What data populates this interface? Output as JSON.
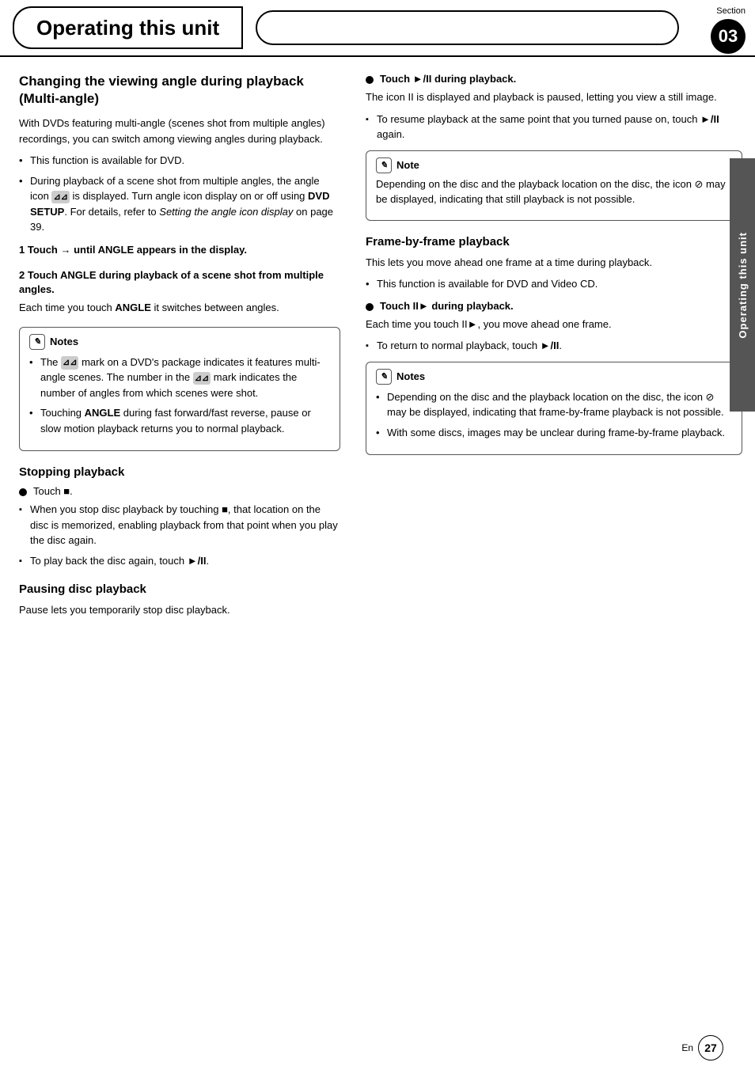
{
  "header": {
    "title": "Operating this unit",
    "section_label": "Section",
    "section_number": "03"
  },
  "side_tab": {
    "text": "Operating this unit"
  },
  "footer": {
    "lang": "En",
    "page_number": "27"
  },
  "left_column": {
    "section1": {
      "heading": "Changing the viewing angle during playback (Multi-angle)",
      "intro": "With DVDs featuring multi-angle (scenes shot from multiple angles) recordings, you can switch among viewing angles during playback.",
      "bullets": [
        "This function is available for DVD.",
        "During playback of a scene shot from multiple angles, the angle icon      is displayed. Turn angle icon display on or off using DVD SETUP. For details, refer to Setting the angle icon display on page 39."
      ],
      "step1_heading": "1   Touch → until ANGLE appears in the display.",
      "step2_heading": "2   Touch ANGLE during playback of a scene shot from multiple angles.",
      "step2_body": "Each time you touch ANGLE it switches between angles.",
      "notes_title": "Notes",
      "notes": [
        "The      mark on a DVD's package indicates it features multi-angle scenes. The number in the      mark indicates the number of angles from which scenes were shot.",
        "Touching ANGLE during fast forward/fast reverse, pause or slow motion playback returns you to normal playback."
      ]
    },
    "section2": {
      "heading": "Stopping playback",
      "circle_bullet": "Touch ■.",
      "square_bullets": [
        "When you stop disc playback by touching ■, that location on the disc is memorized, enabling playback from that point when you play the disc again.",
        "To play back the disc again, touch ►/II."
      ]
    },
    "section3": {
      "heading": "Pausing disc playback",
      "intro": "Pause lets you temporarily stop disc playback."
    }
  },
  "right_column": {
    "section1": {
      "circle_bullet": "Touch ►/II during playback.",
      "body1": "The icon II is displayed and playback is paused, letting you view a still image.",
      "square_bullet": "To resume playback at the same point that you turned pause on, touch ►/II again.",
      "note_title": "Note",
      "note_body": "Depending on the disc and the playback location on the disc, the icon ⊘ may be displayed, indicating that still playback is not possible."
    },
    "section2": {
      "heading": "Frame-by-frame playback",
      "intro": "This lets you move ahead one frame at a time during playback.",
      "bullets": [
        "This function is available for DVD and Video CD."
      ],
      "circle_bullet": "Touch II► during playback.",
      "body1": "Each time you touch II►, you move ahead one frame.",
      "square_bullets": [
        "To return to normal playback, touch ►/II."
      ],
      "notes_title": "Notes",
      "notes": [
        "Depending on the disc and the playback location on the disc, the icon ⊘ may be displayed, indicating that frame-by-frame playback is not possible.",
        "With some discs, images may be unclear during frame-by-frame playback."
      ]
    }
  }
}
